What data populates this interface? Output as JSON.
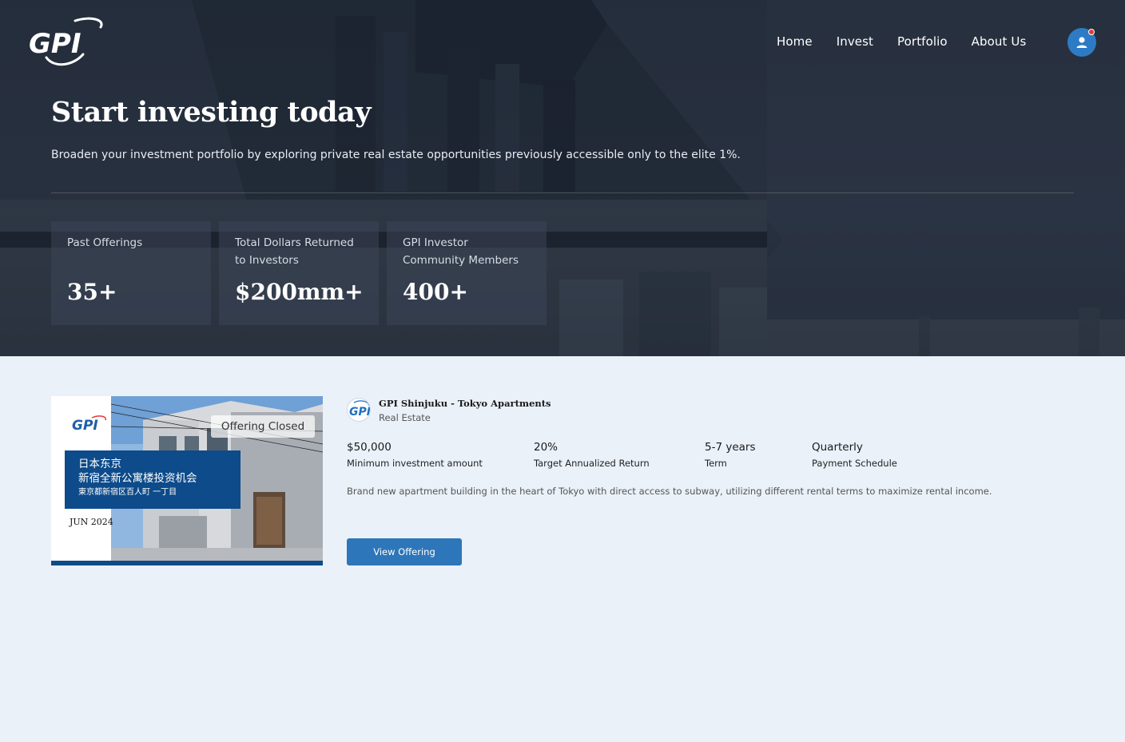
{
  "brand": {
    "logo_text": "GPI",
    "accent": "#2d76b9",
    "navy": "#0d4b8a"
  },
  "nav": {
    "items": [
      {
        "label": "Home"
      },
      {
        "label": "Invest"
      },
      {
        "label": "Portfolio"
      },
      {
        "label": "About Us"
      }
    ],
    "avatar_icon": "user-icon",
    "notification_dot_color": "#e53935"
  },
  "hero": {
    "title": "Start investing today",
    "subtitle": "Broaden your investment portfolio by exploring private real estate opportunities previously accessible only to the elite 1%.",
    "stats": [
      {
        "label_line1": "Past Offerings",
        "label_line2": "",
        "value": "35+"
      },
      {
        "label_line1": "Total Dollars Returned",
        "label_line2": "to Investors",
        "value": "$200mm+"
      },
      {
        "label_line1": "GPI Investor",
        "label_line2": "Community Members",
        "value": "400+"
      }
    ]
  },
  "offering": {
    "status_badge": "Offering Closed",
    "thumb": {
      "logo_text": "GPI",
      "line1": "日本东京",
      "line2": "新宿全新公寓楼投资机会",
      "line3": "東京都新宿区百人町 一丁目",
      "date": "JUN 2024"
    },
    "name": "GPI Shinjuku - Tokyo Apartments",
    "category": "Real Estate",
    "metrics": [
      {
        "value": "$50,000",
        "label": "Minimum investment amount"
      },
      {
        "value": "20%",
        "label": "Target Annualized Return"
      },
      {
        "value": "5-7 years",
        "label": "Term"
      },
      {
        "value": "Quarterly",
        "label": "Payment Schedule"
      }
    ],
    "description": "Brand new apartment building in the heart of Tokyo with direct access to subway, utilizing different rental terms to maximize rental income.",
    "cta_label": "View Offering"
  }
}
